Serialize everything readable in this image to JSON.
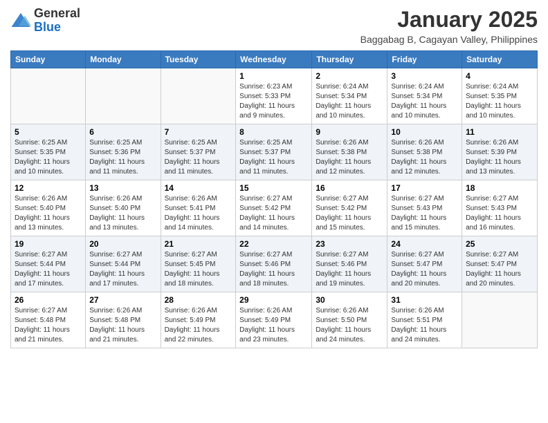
{
  "header": {
    "logo_general": "General",
    "logo_blue": "Blue",
    "month": "January 2025",
    "location": "Baggabag B, Cagayan Valley, Philippines"
  },
  "weekdays": [
    "Sunday",
    "Monday",
    "Tuesday",
    "Wednesday",
    "Thursday",
    "Friday",
    "Saturday"
  ],
  "weeks": [
    [
      {
        "day": "",
        "info": ""
      },
      {
        "day": "",
        "info": ""
      },
      {
        "day": "",
        "info": ""
      },
      {
        "day": "1",
        "info": "Sunrise: 6:23 AM\nSunset: 5:33 PM\nDaylight: 11 hours and 9 minutes."
      },
      {
        "day": "2",
        "info": "Sunrise: 6:24 AM\nSunset: 5:34 PM\nDaylight: 11 hours and 10 minutes."
      },
      {
        "day": "3",
        "info": "Sunrise: 6:24 AM\nSunset: 5:34 PM\nDaylight: 11 hours and 10 minutes."
      },
      {
        "day": "4",
        "info": "Sunrise: 6:24 AM\nSunset: 5:35 PM\nDaylight: 11 hours and 10 minutes."
      }
    ],
    [
      {
        "day": "5",
        "info": "Sunrise: 6:25 AM\nSunset: 5:35 PM\nDaylight: 11 hours and 10 minutes."
      },
      {
        "day": "6",
        "info": "Sunrise: 6:25 AM\nSunset: 5:36 PM\nDaylight: 11 hours and 11 minutes."
      },
      {
        "day": "7",
        "info": "Sunrise: 6:25 AM\nSunset: 5:37 PM\nDaylight: 11 hours and 11 minutes."
      },
      {
        "day": "8",
        "info": "Sunrise: 6:25 AM\nSunset: 5:37 PM\nDaylight: 11 hours and 11 minutes."
      },
      {
        "day": "9",
        "info": "Sunrise: 6:26 AM\nSunset: 5:38 PM\nDaylight: 11 hours and 12 minutes."
      },
      {
        "day": "10",
        "info": "Sunrise: 6:26 AM\nSunset: 5:38 PM\nDaylight: 11 hours and 12 minutes."
      },
      {
        "day": "11",
        "info": "Sunrise: 6:26 AM\nSunset: 5:39 PM\nDaylight: 11 hours and 13 minutes."
      }
    ],
    [
      {
        "day": "12",
        "info": "Sunrise: 6:26 AM\nSunset: 5:40 PM\nDaylight: 11 hours and 13 minutes."
      },
      {
        "day": "13",
        "info": "Sunrise: 6:26 AM\nSunset: 5:40 PM\nDaylight: 11 hours and 13 minutes."
      },
      {
        "day": "14",
        "info": "Sunrise: 6:26 AM\nSunset: 5:41 PM\nDaylight: 11 hours and 14 minutes."
      },
      {
        "day": "15",
        "info": "Sunrise: 6:27 AM\nSunset: 5:42 PM\nDaylight: 11 hours and 14 minutes."
      },
      {
        "day": "16",
        "info": "Sunrise: 6:27 AM\nSunset: 5:42 PM\nDaylight: 11 hours and 15 minutes."
      },
      {
        "day": "17",
        "info": "Sunrise: 6:27 AM\nSunset: 5:43 PM\nDaylight: 11 hours and 15 minutes."
      },
      {
        "day": "18",
        "info": "Sunrise: 6:27 AM\nSunset: 5:43 PM\nDaylight: 11 hours and 16 minutes."
      }
    ],
    [
      {
        "day": "19",
        "info": "Sunrise: 6:27 AM\nSunset: 5:44 PM\nDaylight: 11 hours and 17 minutes."
      },
      {
        "day": "20",
        "info": "Sunrise: 6:27 AM\nSunset: 5:44 PM\nDaylight: 11 hours and 17 minutes."
      },
      {
        "day": "21",
        "info": "Sunrise: 6:27 AM\nSunset: 5:45 PM\nDaylight: 11 hours and 18 minutes."
      },
      {
        "day": "22",
        "info": "Sunrise: 6:27 AM\nSunset: 5:46 PM\nDaylight: 11 hours and 18 minutes."
      },
      {
        "day": "23",
        "info": "Sunrise: 6:27 AM\nSunset: 5:46 PM\nDaylight: 11 hours and 19 minutes."
      },
      {
        "day": "24",
        "info": "Sunrise: 6:27 AM\nSunset: 5:47 PM\nDaylight: 11 hours and 20 minutes."
      },
      {
        "day": "25",
        "info": "Sunrise: 6:27 AM\nSunset: 5:47 PM\nDaylight: 11 hours and 20 minutes."
      }
    ],
    [
      {
        "day": "26",
        "info": "Sunrise: 6:27 AM\nSunset: 5:48 PM\nDaylight: 11 hours and 21 minutes."
      },
      {
        "day": "27",
        "info": "Sunrise: 6:26 AM\nSunset: 5:48 PM\nDaylight: 11 hours and 21 minutes."
      },
      {
        "day": "28",
        "info": "Sunrise: 6:26 AM\nSunset: 5:49 PM\nDaylight: 11 hours and 22 minutes."
      },
      {
        "day": "29",
        "info": "Sunrise: 6:26 AM\nSunset: 5:49 PM\nDaylight: 11 hours and 23 minutes."
      },
      {
        "day": "30",
        "info": "Sunrise: 6:26 AM\nSunset: 5:50 PM\nDaylight: 11 hours and 24 minutes."
      },
      {
        "day": "31",
        "info": "Sunrise: 6:26 AM\nSunset: 5:51 PM\nDaylight: 11 hours and 24 minutes."
      },
      {
        "day": "",
        "info": ""
      }
    ]
  ]
}
